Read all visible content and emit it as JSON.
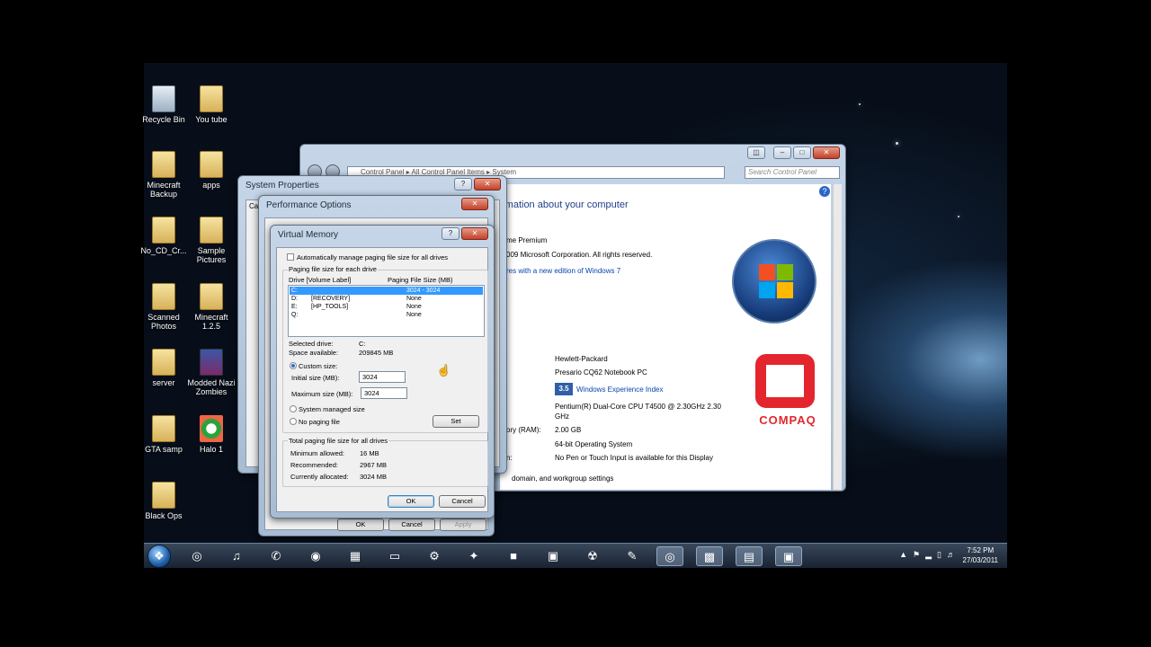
{
  "desktop": {
    "icons": [
      {
        "label": "Recycle Bin",
        "icon": "recycle-bin-icon"
      },
      {
        "label": "You tube",
        "icon": "folder-icon"
      },
      {
        "label": "Minecraft Backup",
        "icon": "folder-icon"
      },
      {
        "label": "apps",
        "icon": "folder-icon"
      },
      {
        "label": "No_CD_Cr...",
        "icon": "folder-icon"
      },
      {
        "label": "Sample Pictures",
        "icon": "folder-icon"
      },
      {
        "label": "Scanned Photos",
        "icon": "folder-icon"
      },
      {
        "label": "Minecraft 1.2.5",
        "icon": "folder-icon"
      },
      {
        "label": "server",
        "icon": "folder-icon"
      },
      {
        "label": "Modded Nazi Zombies",
        "icon": "winrar-icon"
      },
      {
        "label": "GTA samp",
        "icon": "folder-icon"
      },
      {
        "label": "Halo 1",
        "icon": "halo-icon"
      },
      {
        "label": "Black Ops",
        "icon": "folder-icon"
      }
    ]
  },
  "control_panel": {
    "address": {
      "part1": "Control Panel",
      "part2": "All Control Panel Items",
      "part3": "System"
    },
    "search_placeholder": "Search Control Panel",
    "heading": "rmation about your computer",
    "edition": "me Premium",
    "copyright": "009 Microsoft Corporation.  All rights reserved.",
    "upgrade_link": "res with a new edition of Windows 7",
    "manufacturer": "Hewlett-Packard",
    "model": "Presario CQ62 Notebook PC",
    "rating_score": "3.5",
    "rating_link": "Windows Experience Index",
    "processor_line1": "Pentium(R) Dual-Core CPU     T4500  @ 2.30GHz   2.30",
    "processor_line2": "GHz",
    "ram_label": "ory (RAM):",
    "ram": "2.00 GB",
    "system_type": "64-bit Operating System",
    "pen_label": "n:",
    "pen": "No Pen or Touch Input is available for this Display",
    "domain_text": "domain, and workgroup settings",
    "oem_logo_text": "COMPAQ"
  },
  "system_properties": {
    "title": "System Properties",
    "tab_stub": "Ca"
  },
  "performance_options": {
    "title": "Performance Options",
    "ok": "OK",
    "cancel": "Cancel",
    "apply": "Apply"
  },
  "virtual_memory": {
    "title": "Virtual Memory",
    "auto_manage": "Automatically manage paging file size for all drives",
    "auto_manage_checked": false,
    "group_label": "Paging file size for each drive",
    "col_drive": "Drive  [Volume Label]",
    "col_size": "Paging File Size (MB)",
    "drives": [
      {
        "drive": "C:",
        "label": "",
        "size": "3024 - 3024",
        "selected": true
      },
      {
        "drive": "D:",
        "label": "[RECOVERY]",
        "size": "None",
        "selected": false
      },
      {
        "drive": "E:",
        "label": "[HP_TOOLS]",
        "size": "None",
        "selected": false
      },
      {
        "drive": "Q:",
        "label": "",
        "size": "None",
        "selected": false
      }
    ],
    "selected_drive_label": "Selected drive:",
    "selected_drive": "C:",
    "space_label": "Space available:",
    "space": "209845 MB",
    "custom_size": "Custom size:",
    "initial_label": "Initial size (MB):",
    "initial_value": "3024",
    "max_label": "Maximum size (MB):",
    "max_value": "3024",
    "system_managed": "System managed size",
    "no_paging": "No paging file",
    "set": "Set",
    "total_label": "Total paging file size for all drives",
    "min_label": "Minimum allowed:",
    "min_value": "16 MB",
    "rec_label": "Recommended:",
    "rec_value": "2967 MB",
    "cur_label": "Currently allocated:",
    "cur_value": "3024 MB",
    "ok": "OK",
    "cancel": "Cancel"
  },
  "taskbar": {
    "start_icon": "windows-start-icon",
    "clock_time": "7:52 PM",
    "clock_date": "27/03/2011"
  },
  "colors": {
    "selection": "#3399ff",
    "link": "#0645ad",
    "compaq_red": "#e3262d"
  }
}
